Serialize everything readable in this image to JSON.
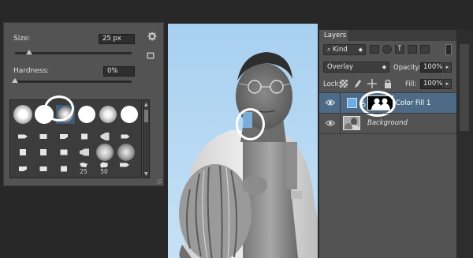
{
  "brush": {
    "size_label": "Size:",
    "size_value": "25 px",
    "size_level": 0.12,
    "hardness_label": "Hardness:",
    "hardness_value": "0%",
    "hardness_level": 0.0,
    "gear_icon": "gear-icon",
    "tip_labels": [
      "25",
      "50"
    ]
  },
  "layers": {
    "tab_label": "Layers",
    "filter_value": "Kind",
    "blend_mode": "Overlay",
    "opacity_label": "Opacity:",
    "opacity_value": "100%",
    "lock_label": "Lock:",
    "fill_label": "Fill:",
    "fill_value": "100%",
    "items": [
      {
        "name": "Color Fill 1",
        "selected": true,
        "swatch": "#6aaee8"
      },
      {
        "name": "Background",
        "selected": false
      }
    ]
  },
  "colors": {
    "panel": "#535353",
    "selected_row": "#4d6b87",
    "fill_swatch": "#6aaee8",
    "sky": "#a9cfee"
  }
}
